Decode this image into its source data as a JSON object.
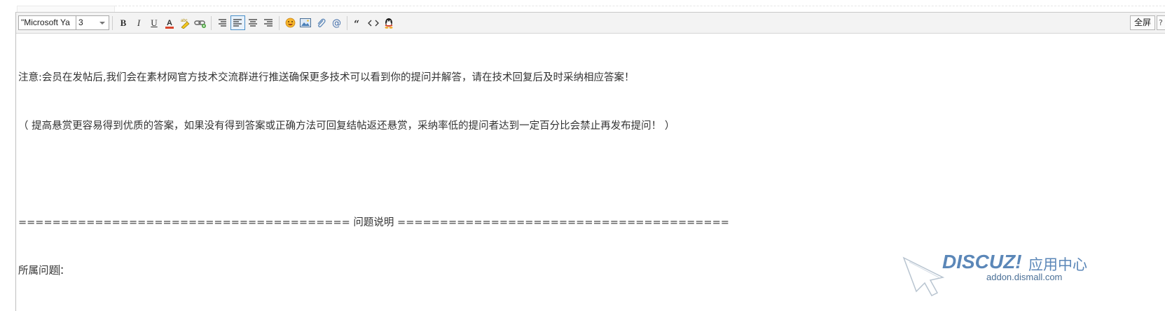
{
  "toolbar": {
    "font_value": "\"Microsoft Ya",
    "size_value": "3",
    "bold_label": "B",
    "italic_label": "I",
    "underline_label": "U",
    "fullscreen_label": "全屏",
    "help_label": "?"
  },
  "content": {
    "line1": "注意:会员在发帖后,我们会在素材网官方技术交流群进行推送确保更多技术可以看到你的提问并解答，请在技术回复后及时采纳相应答案！",
    "line2": "（ 提高悬赏更容易得到优质的答案，如果没有得到答案或正确方法可回复结帖返还悬赏，采纳率低的提问者达到一定百分比会禁止再发布提问！ ）",
    "line3": "",
    "line4": "======================================= 问题说明 =======================================",
    "line5": "所属问题："
  },
  "watermark": {
    "brand": "DISCUZ!",
    "cn": "应用中心",
    "url": "addon.dismall.com"
  },
  "colors": {
    "toolbar_bg": "#f3f3f3",
    "active_border": "#4a8fc9",
    "text": "#333333",
    "watermark": "#5b87b8"
  }
}
